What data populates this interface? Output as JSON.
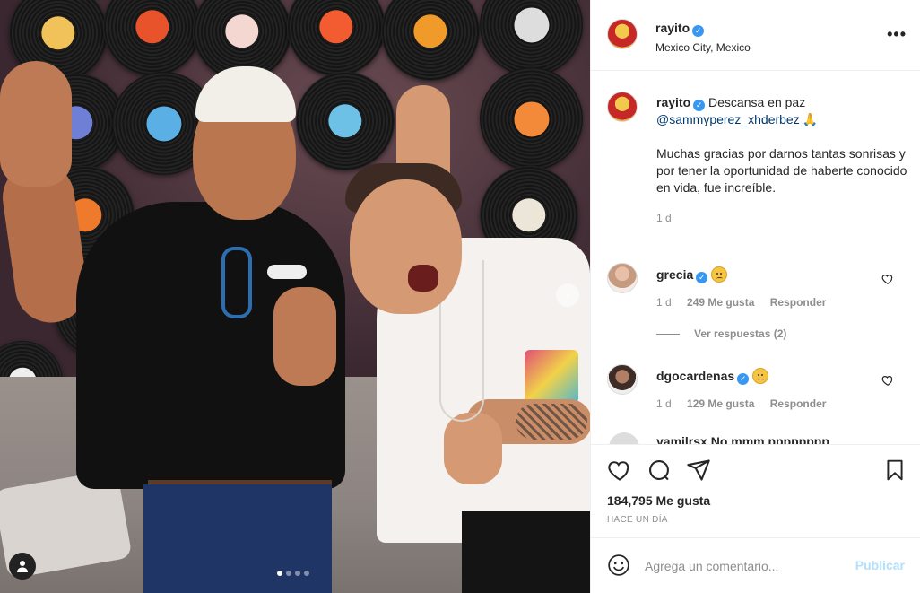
{
  "post": {
    "username": "rayito",
    "location": "Mexico City, Mexico",
    "more_label": "•••"
  },
  "caption": {
    "username": "rayito",
    "text_before": "Descansa en paz",
    "mention": "@sammyperez_xhderbez",
    "body": "Muchas gracias por darnos tantas sonrisas y por tener la oportunidad de haberte conocido en vida, fue increíble.",
    "age": "1 d"
  },
  "comments": [
    {
      "username": "grecia",
      "age": "1 d",
      "likes": "249 Me gusta",
      "reply": "Responder"
    },
    {
      "username": "dgocardenas",
      "age": "1 d",
      "likes": "129 Me gusta",
      "reply": "Responder"
    }
  ],
  "view_replies": "Ver respuestas (2)",
  "cut_comment": "yamilrsx  No mmm pppppppp",
  "actions": {
    "likes": "184,795 Me gusta",
    "time": "HACE UN DÍA"
  },
  "composer": {
    "placeholder": "Agrega un comentario...",
    "publish": "Publicar"
  },
  "carousel": {
    "slides": 4,
    "active": 1
  },
  "colors": {
    "verified": "#3897f0",
    "mention": "#00376b",
    "publish_disabled": "#b2dffc",
    "muted": "#8e8e8e"
  }
}
